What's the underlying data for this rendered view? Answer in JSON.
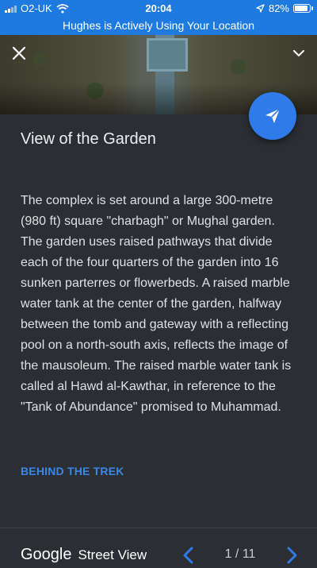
{
  "status_bar": {
    "carrier": "O2-UK",
    "time": "20:04",
    "battery": "82%",
    "battery_level": 0.82,
    "icons": [
      "signal-icon",
      "wifi-icon",
      "location-arrow-icon",
      "battery-icon"
    ]
  },
  "location_banner": "Hughes is Actively Using Your Location",
  "header": {
    "close_icon": "close-icon",
    "collapse_icon": "chevron-down-icon",
    "share_icon": "send-icon"
  },
  "panel": {
    "title": "View of the Garden",
    "description": "The complex is set around a large 300-metre (980 ft) square \"charbagh\" or Mughal garden. The garden uses raised pathways that divide each of the four quarters of the garden into 16 sunken parterres or flowerbeds. A raised marble water tank at the center of the garden, halfway between the tomb and gateway with a reflecting pool on a north-south axis, reflects the image of the mausoleum. The raised marble water tank is called al Hawd al-Kawthar, in reference to the \"Tank of Abundance\" promised to Muhammad.",
    "link": "BEHIND THE TREK"
  },
  "footer": {
    "brand_google": "Google",
    "brand_product": "Street View",
    "pager": "1 / 11"
  },
  "colors": {
    "accent": "#2f7bea",
    "banner": "#1f7ae0",
    "panel_bg": "#2b2f33",
    "link": "#3b87e8"
  }
}
